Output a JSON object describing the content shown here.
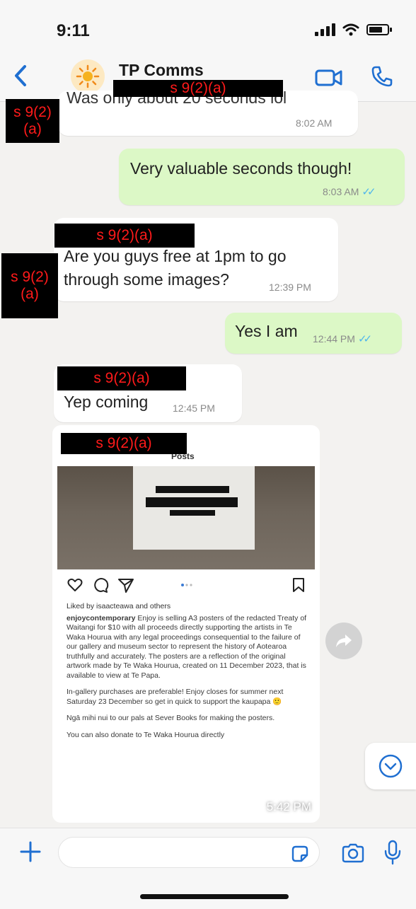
{
  "status_bar": {
    "time": "9:11"
  },
  "header": {
    "title": "TP Comms"
  },
  "redaction_label": "s 9(2)(a)",
  "redaction_label_split": [
    "s 9(2)",
    "(a)"
  ],
  "messages": [
    {
      "direction": "in",
      "text": "Was only about 20 seconds lol",
      "time": "8:02 AM"
    },
    {
      "direction": "out",
      "text": "Very valuable seconds though!",
      "time": "8:03 AM"
    },
    {
      "direction": "in",
      "text_lines": [
        "Are you guys free at 1pm to go",
        "through some images?"
      ],
      "time": "12:39 PM"
    },
    {
      "direction": "out",
      "text": "Yes I am",
      "time": "12:44 PM"
    },
    {
      "direction": "in",
      "text": "Yep coming",
      "time": "12:45 PM"
    }
  ],
  "image_message": {
    "time": "5:42 PM",
    "ig_header": "Posts",
    "likes_text": "Liked by isaacteawa and others",
    "caption_user": "enjoycontemporary",
    "caption_body": "Enjoy is selling A3 posters of the redacted Treaty of Waitangi for $10 with all proceeds directly supporting the artists in Te Waka Hourua with any legal proceedings consequential to the failure of our gallery and museum sector to represent the history of Aotearoa truthfully and accurately. The posters are a reflection of the original artwork made by Te Waka Hourua, created on 11 December 2023, that is available to view at Te Papa.",
    "caption_para2": "In-gallery purchases are preferable! Enjoy closes for summer next Saturday 23 December so get in quick to support the kaupapa 🙂",
    "caption_para3": "Ngā mihi nui to our pals at Sever Books for making the posters.",
    "caption_para4": "You can also donate to Te Waka Hourua directly"
  },
  "icons": {
    "back": "chevron-left-icon",
    "video": "video-call-icon",
    "phone": "phone-call-icon",
    "plus": "plus-icon",
    "sticker": "sticker-icon",
    "camera": "camera-icon",
    "mic": "microphone-icon"
  },
  "colors": {
    "accent": "#1f6fd1",
    "outgoing_bubble": "#dcf8c6",
    "incoming_bubble": "#ffffff",
    "redaction_text": "#ff1a1a",
    "read_ticks": "#4fb6ec"
  }
}
